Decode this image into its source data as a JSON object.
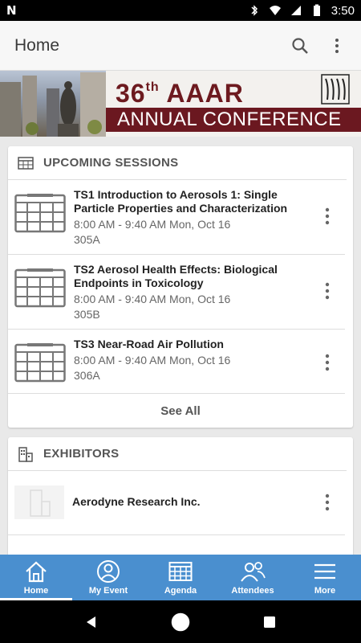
{
  "status_bar": {
    "time": "3:50",
    "left_icon": "N"
  },
  "app_bar": {
    "title": "Home"
  },
  "banner": {
    "edition": "36",
    "edition_suffix": "th",
    "org": "AAAR",
    "subtitle": "ANNUAL CONFERENCE"
  },
  "upcoming": {
    "header": "UPCOMING SESSIONS",
    "items": [
      {
        "title": " TS1 Introduction to Aerosols 1: Single Particle Properties and Characterization",
        "time": "8:00 AM - 9:40 AM Mon, Oct 16",
        "room": "305A"
      },
      {
        "title": "TS2 Aerosol Health Effects: Biological Endpoints in Toxicology",
        "time": "8:00 AM - 9:40 AM Mon, Oct 16",
        "room": "305B"
      },
      {
        "title": "TS3 Near-Road Air Pollution",
        "time": "8:00 AM - 9:40 AM Mon, Oct 16",
        "room": "306A"
      }
    ],
    "see_all": "See All"
  },
  "exhibitors": {
    "header": "EXHIBITORS",
    "items": [
      {
        "name": "Aerodyne Research Inc."
      }
    ]
  },
  "bottom_nav": {
    "items": [
      {
        "label": "Home"
      },
      {
        "label": "My Event"
      },
      {
        "label": "Agenda"
      },
      {
        "label": "Attendees"
      },
      {
        "label": "More"
      }
    ]
  },
  "colors": {
    "nav_bg": "#4a8fcf",
    "banner_maroon": "#6b1820"
  }
}
